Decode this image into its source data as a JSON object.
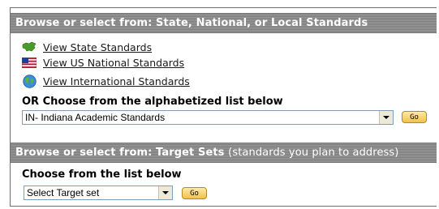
{
  "state_section": {
    "title": "Browse or select from: State, National, or Local Standards",
    "links": [
      {
        "label": "View State Standards",
        "icon": "map-icon"
      },
      {
        "label": "View US National Standards",
        "icon": "us-flag-icon"
      },
      {
        "label": "View International Standards",
        "icon": "globe-icon"
      }
    ],
    "list_heading": "OR Choose from the alphabetized list below",
    "select_value": "IN- Indiana Academic Standards",
    "go_label": "Go"
  },
  "target_section": {
    "title": "Browse or select from: Target Sets",
    "title_note": "(standards you plan to address)",
    "list_heading": "Choose from the list below",
    "select_value": "Select Target set",
    "go_label": "Go"
  },
  "colors": {
    "header_bar": "#8a8a8a",
    "go_button": "#f2c24a"
  }
}
